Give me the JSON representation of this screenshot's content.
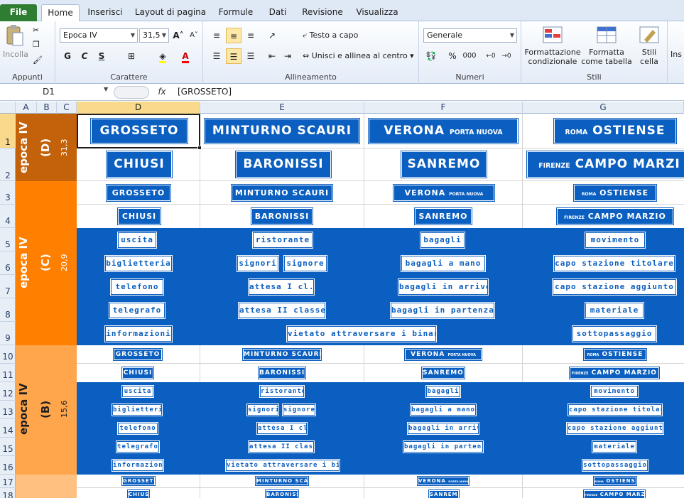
{
  "tabs": [
    "File",
    "Home",
    "Inserisci",
    "Layout di pagina",
    "Formule",
    "Dati",
    "Revisione",
    "Visualizza"
  ],
  "ribbon": {
    "clipboard": {
      "paste": "Incolla",
      "group": "Appunti"
    },
    "font": {
      "name": "Epoca IV",
      "size": "31,5",
      "bold": "G",
      "italic": "C",
      "underline": "S",
      "group": "Carattere"
    },
    "alignment": {
      "wrap": "Testo a capo",
      "merge": "Unisci e allinea al centro",
      "group": "Allineamento"
    },
    "number": {
      "format": "Generale",
      "percent": "%",
      "thousands": "000",
      "group": "Numeri"
    },
    "styles": {
      "conditional": "Formattazione",
      "conditional2": "condizionale",
      "table": "Formatta",
      "table2": "come tabella",
      "cell": "Stili",
      "cell2": "cella",
      "group": "Stili"
    },
    "insert": "Ins"
  },
  "formula_bar": {
    "name_box": "D1",
    "fx": "fx",
    "value": "[GROSSETO]"
  },
  "columns": [
    "A",
    "B",
    "C",
    "D",
    "E",
    "F",
    "G"
  ],
  "rows": [
    "1",
    "2",
    "3",
    "4",
    "5",
    "6",
    "7",
    "8",
    "9",
    "10",
    "11",
    "12",
    "13",
    "14",
    "15",
    "16",
    "17",
    "18"
  ],
  "bands": {
    "d": {
      "label": "epoca IV",
      "code": "(D)",
      "size": "31,3"
    },
    "c": {
      "label": "epoca IV",
      "code": "(C)",
      "size": "20,9"
    },
    "b": {
      "label": "epoca IV",
      "code": "(B)",
      "size": "15,6"
    }
  },
  "stations": {
    "grosseto": "GROSSETO",
    "minturno": "MINTURNO SCAURI",
    "verona": "VERONA",
    "verona_small": "PORTA NUOVA",
    "roma_small": "ROMA",
    "roma": "OSTIENSE",
    "chiusi": "CHIUSI",
    "baronissi": "BARONISSI",
    "sanremo": "SANREMO",
    "firenze_small": "FIRENZE",
    "firenze": "CAMPO MARZIO",
    "firenze_cut": "CAMPO MARZI"
  },
  "plates": {
    "uscita": "uscita",
    "ristorante": "ristorante",
    "bagagli": "bagagli",
    "movimento": "movimento",
    "biglietteria": "biglietteria",
    "signori": "signori",
    "signore": "signore",
    "bagagli_mano": "bagagli a mano",
    "capo_titolare": "capo stazione titolare",
    "telefono": "telefono",
    "attesa1": "attesa I cl.",
    "bagagli_arrivo": "bagagli in arrivo",
    "capo_aggiunto": "capo stazione aggiunto",
    "telegrafo": "telegrafo",
    "attesa2": "attesa II classe",
    "bagagli_partenza": "bagagli in partenza",
    "materiale": "materiale",
    "informazioni": "informazioni",
    "vietato": "vietato attraversare i binari",
    "sottopassaggio": "sottopassaggio"
  },
  "colors": {
    "blue": "#0b5fc0",
    "band_d": "#c3620a",
    "band_c": "#ff7f00",
    "band_b": "#ffa64d",
    "band_a": "#ffc080",
    "selected": "#f9d98c"
  }
}
